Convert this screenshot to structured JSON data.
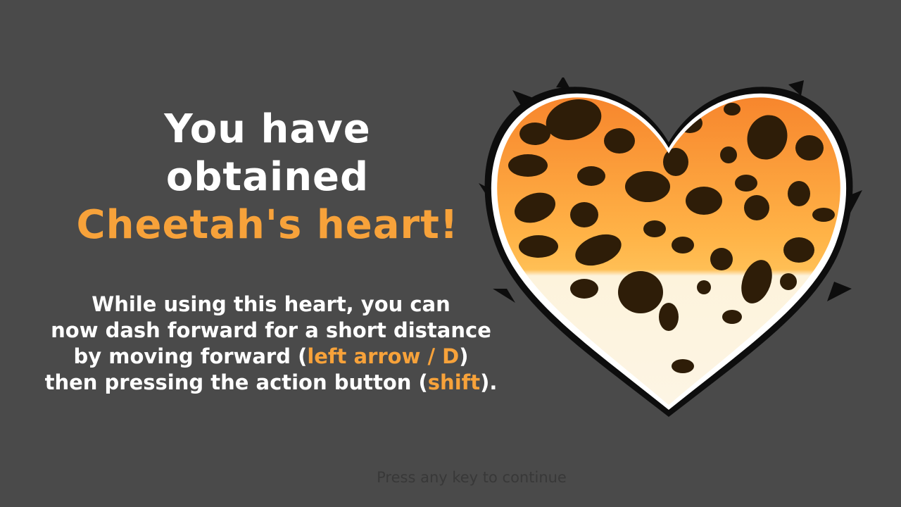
{
  "title": {
    "line1": "You have",
    "line2": "obtained",
    "line3": "Cheetah's heart!"
  },
  "description": {
    "line1": "While using this heart, you can",
    "line2": "now dash forward for a short distance",
    "line3_pre": "by moving forward (",
    "line3_key": "left arrow / D",
    "line3_post": ")",
    "line4_pre": "then pressing the action button (",
    "line4_key": "shift",
    "line4_post": ")."
  },
  "prompt": "Press any key to continue",
  "colors": {
    "background": "#4a4a4a",
    "accent": "#f7a23a",
    "text": "#ffffff",
    "prompt": "#383838",
    "heart_top": "#f7862d",
    "heart_mid": "#ffb347",
    "heart_bottom": "#fdf3dc",
    "spots": "#2e1d08"
  },
  "icon": "cheetah-heart-icon"
}
